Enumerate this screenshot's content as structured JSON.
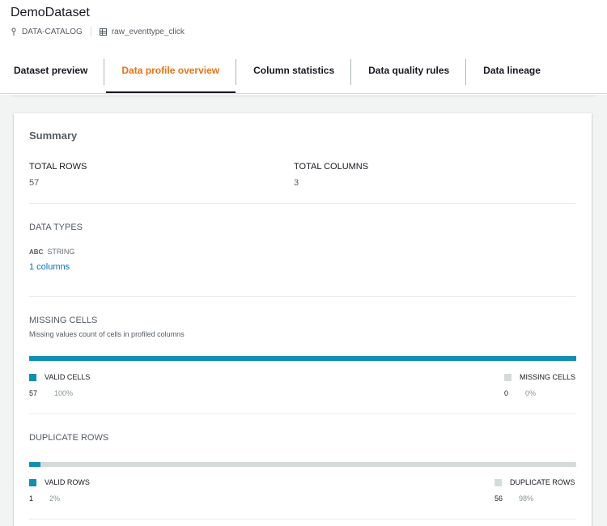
{
  "dataset": {
    "title": "DemoDataset",
    "catalog": "DATA-CATALOG",
    "table": "raw_eventtype_click"
  },
  "tabs": [
    {
      "label": "Dataset preview",
      "active": false
    },
    {
      "label": "Data profile overview",
      "active": true
    },
    {
      "label": "Column statistics",
      "active": false
    },
    {
      "label": "Data quality rules",
      "active": false
    },
    {
      "label": "Data lineage",
      "active": false
    }
  ],
  "summary": {
    "heading": "Summary",
    "total_rows_label": "TOTAL ROWS",
    "total_rows": "57",
    "total_columns_label": "TOTAL COLUMNS",
    "total_columns": "3"
  },
  "data_types": {
    "heading": "DATA TYPES",
    "type_icon": "ABC",
    "type_name": "STRING",
    "columns_link": "1 columns"
  },
  "missing_cells": {
    "heading": "MISSING CELLS",
    "description": "Missing values count of cells in profiled columns",
    "valid_fraction": 1.0,
    "valid_label": "VALID CELLS",
    "valid_count": "57",
    "valid_pct": "100%",
    "missing_label": "MISSING CELLS",
    "missing_count": "0",
    "missing_pct": "0%"
  },
  "duplicate_rows": {
    "heading": "DUPLICATE ROWS",
    "valid_fraction": 0.02,
    "valid_label": "VALID ROWS",
    "valid_count": "1",
    "valid_pct": "2%",
    "duplicate_label": "DUPLICATE ROWS",
    "duplicate_count": "56",
    "duplicate_pct": "98%"
  },
  "colors": {
    "accent": "#0f8fb3",
    "active_tab": "#ec7211",
    "link": "#0073bb",
    "neutral": "#d5dbdb"
  }
}
